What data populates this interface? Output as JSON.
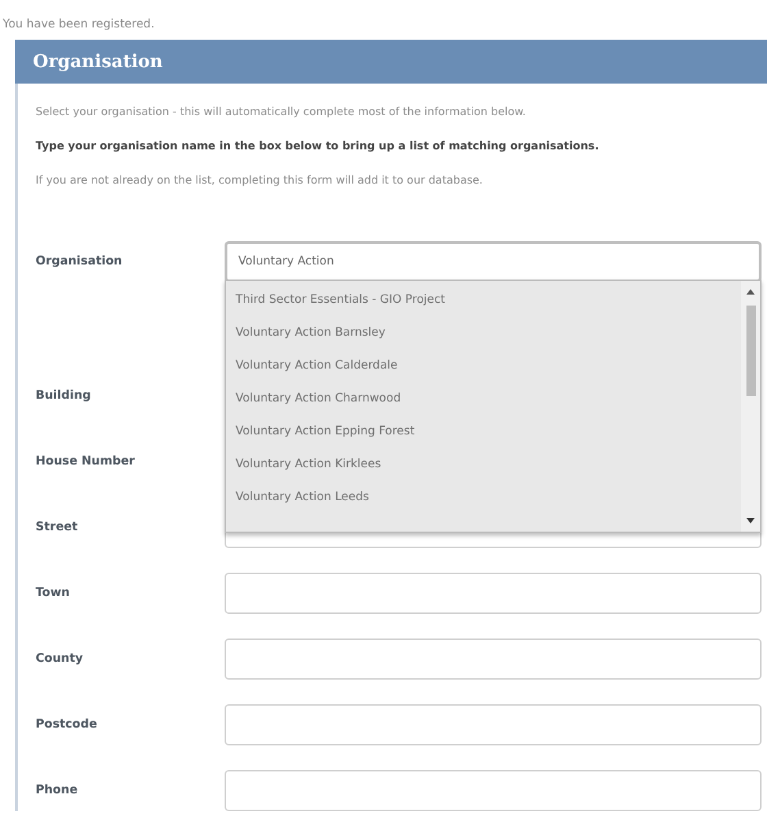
{
  "notice": "You have been registered.",
  "panel": {
    "title": "Organisation",
    "intro": [
      "Select your organisation - this will automatically complete most of the information below.",
      "**Type your organisation name in the box below to bring up a list of matching organisations.**",
      "If you are not already on the list, completing this form will add it to our database."
    ],
    "organisation": {
      "label": "Organisation",
      "value": "Voluntary Action",
      "suggestions": [
        "Third Sector Essentials - GIO Project",
        "Voluntary Action Barnsley",
        "Voluntary Action Calderdale",
        "Voluntary Action Charnwood",
        "Voluntary Action Epping Forest",
        "Voluntary Action Kirklees",
        "Voluntary Action Leeds"
      ]
    },
    "fields": [
      {
        "label": "Building",
        "kind": "covered"
      },
      {
        "label": "House Number",
        "kind": "covered"
      },
      {
        "label": "Street",
        "kind": "input"
      },
      {
        "label": "Town",
        "kind": "input"
      },
      {
        "label": "County",
        "kind": "input"
      },
      {
        "label": "Postcode",
        "kind": "input"
      },
      {
        "label": "Phone",
        "kind": "input"
      }
    ]
  }
}
